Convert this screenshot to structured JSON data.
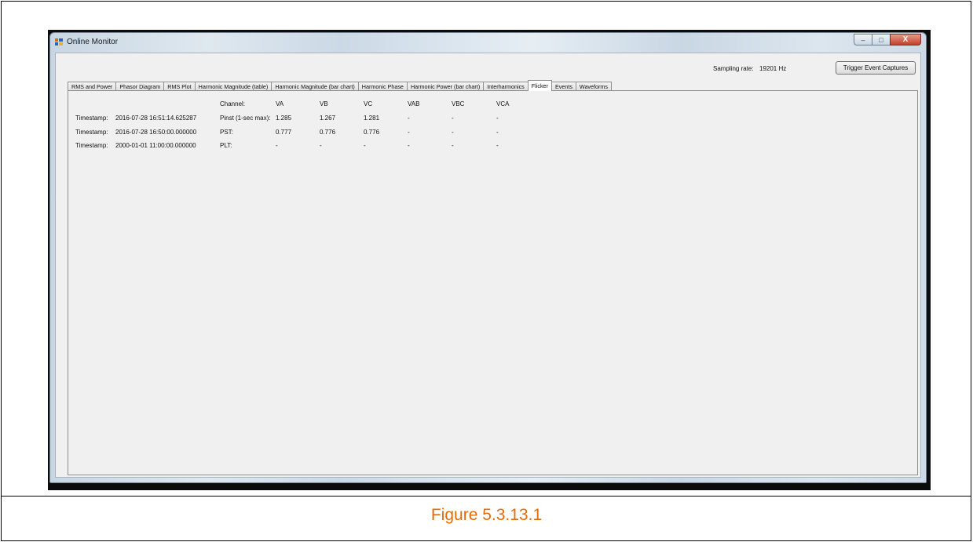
{
  "caption": "Figure 5.3.13.1",
  "window": {
    "title": "Online Monitor",
    "controls": {
      "minimize": "–",
      "maximize": "□",
      "close": "X"
    }
  },
  "toolbar": {
    "sampling_label": "Sampling rate:",
    "sampling_value": "19201 Hz",
    "trigger_label": "Trigger Event Captures"
  },
  "tabs": [
    {
      "label": "RMS and Power"
    },
    {
      "label": "Phasor Diagram"
    },
    {
      "label": "RMS Plot"
    },
    {
      "label": "Harmonic Magnitude (table)"
    },
    {
      "label": "Harmonic Magnitude (bar chart)"
    },
    {
      "label": "Harmonic Phase"
    },
    {
      "label": "Harmonic Power (bar chart)"
    },
    {
      "label": "Interharmonics"
    },
    {
      "label": "Flicker",
      "active": true
    },
    {
      "label": "Events"
    },
    {
      "label": "Waveforms"
    }
  ],
  "flicker": {
    "channel_label": "Channel:",
    "columns": [
      "VA",
      "VB",
      "VC",
      "VAB",
      "VBC",
      "VCA"
    ],
    "rows": [
      {
        "ts_label": "Timestamp:",
        "timestamp": "2016-07-28 16:51:14.625287",
        "metric": "Pinst (1-sec max):",
        "values": [
          "1.285",
          "1.267",
          "1.281",
          "-",
          "-",
          "-"
        ]
      },
      {
        "ts_label": "Timestamp:",
        "timestamp": "2016-07-28 16:50:00.000000",
        "metric": "PST:",
        "values": [
          "0.777",
          "0.776",
          "0.776",
          "-",
          "-",
          "-"
        ]
      },
      {
        "ts_label": "Timestamp:",
        "timestamp": "2000-01-01 11:00:00.000000",
        "metric": "PLT:",
        "values": [
          "-",
          "-",
          "-",
          "-",
          "-",
          "-"
        ]
      }
    ]
  }
}
